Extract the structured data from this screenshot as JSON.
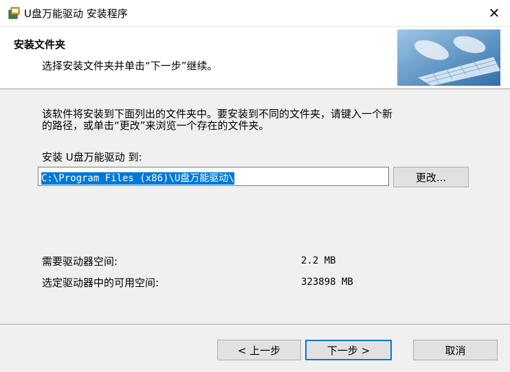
{
  "window": {
    "title": "U盘万能驱动 安装程序",
    "close_glyph": "✕"
  },
  "header": {
    "title": "安装文件夹",
    "subtitle": "选择安装文件夹并单击“下一步”继续。"
  },
  "body": {
    "description_line1": "该软件将安装到下面列出的文件夹中。要安装到不同的文件夹，请键入一个新",
    "description_line2": "的路径，或单击“更改”来浏览一个存在的文件夹。",
    "install_to_label": "安装 U盘万能驱动 到:",
    "install_path": "C:\\Program Files (x86)\\U盘万能驱动\\",
    "browse_button": "更改..."
  },
  "space": {
    "required_label": "需要驱动器空间:",
    "required_value": "2.2 MB",
    "available_label": "选定驱动器中的可用空间:",
    "available_value": "323898 MB"
  },
  "footer": {
    "back_button": "< 上一步",
    "next_button": "下一步 >",
    "cancel_button": "取消"
  },
  "colors": {
    "accent": "#0078d7",
    "dialog_bg": "#f0f0f0",
    "header_bg": "#ffffff"
  }
}
